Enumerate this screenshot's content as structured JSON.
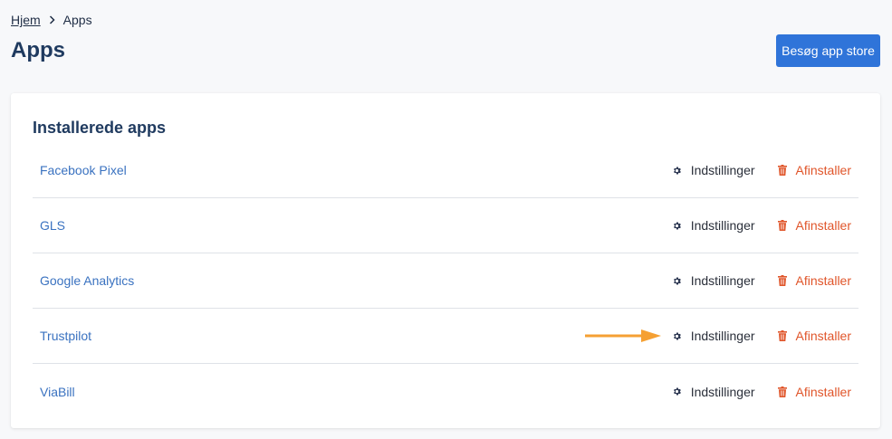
{
  "breadcrumb": {
    "home": "Hjem",
    "current": "Apps"
  },
  "page": {
    "title": "Apps"
  },
  "store_button": {
    "label": "Besøg app store"
  },
  "card": {
    "title": "Installerede apps"
  },
  "apps": [
    {
      "name": "Facebook Pixel",
      "settings_label": "Indstillinger",
      "uninstall_label": "Afinstaller"
    },
    {
      "name": "GLS",
      "settings_label": "Indstillinger",
      "uninstall_label": "Afinstaller"
    },
    {
      "name": "Google Analytics",
      "settings_label": "Indstillinger",
      "uninstall_label": "Afinstaller"
    },
    {
      "name": "Trustpilot",
      "settings_label": "Indstillinger",
      "uninstall_label": "Afinstaller"
    },
    {
      "name": "ViaBill",
      "settings_label": "Indstillinger",
      "uninstall_label": "Afinstaller"
    }
  ],
  "icons": {
    "settings": "gear-icon",
    "uninstall": "trash-icon",
    "separator": "chevron-right-icon",
    "annotation": "arrow-right-icon"
  },
  "colors": {
    "primary": "#2f74d9",
    "link": "#3a72c0",
    "danger": "#e0552a",
    "annotation": "#f5a033"
  }
}
